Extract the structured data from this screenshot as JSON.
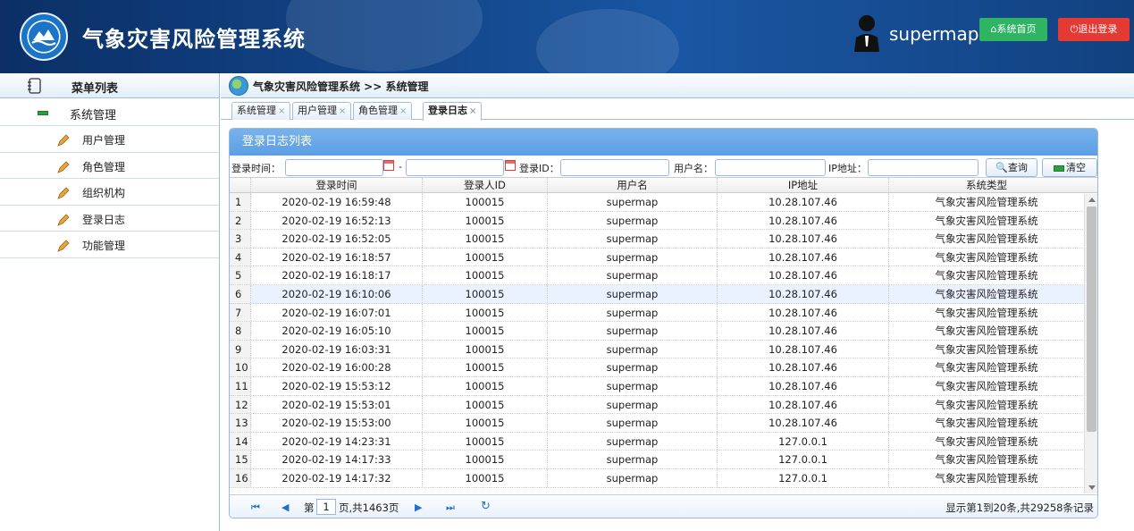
{
  "header": {
    "app_title": "气象灾害风险管理系统",
    "username": "supermap",
    "home_label": "系统首页",
    "logout_label": "退出登录"
  },
  "sidebar": {
    "menu_title": "菜单列表",
    "group_label": "系统管理",
    "items": [
      {
        "label": "用户管理"
      },
      {
        "label": "角色管理"
      },
      {
        "label": "组织机构"
      },
      {
        "label": "登录日志"
      },
      {
        "label": "功能管理"
      }
    ]
  },
  "breadcrumb": {
    "text": "气象灾害风险管理系统 >> 系统管理"
  },
  "tabs": [
    {
      "label": "系统管理",
      "close": "×"
    },
    {
      "label": "用户管理",
      "close": "×"
    },
    {
      "label": "角色管理",
      "close": "×"
    },
    {
      "label": "登录日志",
      "close": "×",
      "active": true
    }
  ],
  "panel": {
    "title": "登录日志列表",
    "search": {
      "login_time_label": "登录时间：",
      "range_sep": "-",
      "login_id_label": "登录ID：",
      "username_label": "用户名：",
      "ip_label": "IP地址：",
      "query_label": "查询",
      "clear_label": "清空"
    },
    "columns": [
      "登录时间",
      "登录人ID",
      "用户名",
      "IP地址",
      "系统类型"
    ],
    "rows": [
      {
        "n": "1",
        "time": "2020-02-19 16:59:48",
        "id": "100015",
        "user": "supermap",
        "ip": "10.28.107.46",
        "sys": "气象灾害风险管理系统"
      },
      {
        "n": "2",
        "time": "2020-02-19 16:52:13",
        "id": "100015",
        "user": "supermap",
        "ip": "10.28.107.46",
        "sys": "气象灾害风险管理系统"
      },
      {
        "n": "3",
        "time": "2020-02-19 16:52:05",
        "id": "100015",
        "user": "supermap",
        "ip": "10.28.107.46",
        "sys": "气象灾害风险管理系统"
      },
      {
        "n": "4",
        "time": "2020-02-19 16:18:57",
        "id": "100015",
        "user": "supermap",
        "ip": "10.28.107.46",
        "sys": "气象灾害风险管理系统"
      },
      {
        "n": "5",
        "time": "2020-02-19 16:18:17",
        "id": "100015",
        "user": "supermap",
        "ip": "10.28.107.46",
        "sys": "气象灾害风险管理系统"
      },
      {
        "n": "6",
        "time": "2020-02-19 16:10:06",
        "id": "100015",
        "user": "supermap",
        "ip": "10.28.107.46",
        "sys": "气象灾害风险管理系统"
      },
      {
        "n": "7",
        "time": "2020-02-19 16:07:01",
        "id": "100015",
        "user": "supermap",
        "ip": "10.28.107.46",
        "sys": "气象灾害风险管理系统"
      },
      {
        "n": "8",
        "time": "2020-02-19 16:05:10",
        "id": "100015",
        "user": "supermap",
        "ip": "10.28.107.46",
        "sys": "气象灾害风险管理系统"
      },
      {
        "n": "9",
        "time": "2020-02-19 16:03:31",
        "id": "100015",
        "user": "supermap",
        "ip": "10.28.107.46",
        "sys": "气象灾害风险管理系统"
      },
      {
        "n": "10",
        "time": "2020-02-19 16:00:28",
        "id": "100015",
        "user": "supermap",
        "ip": "10.28.107.46",
        "sys": "气象灾害风险管理系统"
      },
      {
        "n": "11",
        "time": "2020-02-19 15:53:12",
        "id": "100015",
        "user": "supermap",
        "ip": "10.28.107.46",
        "sys": "气象灾害风险管理系统"
      },
      {
        "n": "12",
        "time": "2020-02-19 15:53:01",
        "id": "100015",
        "user": "supermap",
        "ip": "10.28.107.46",
        "sys": "气象灾害风险管理系统"
      },
      {
        "n": "13",
        "time": "2020-02-19 15:53:00",
        "id": "100015",
        "user": "supermap",
        "ip": "10.28.107.46",
        "sys": "气象灾害风险管理系统"
      },
      {
        "n": "14",
        "time": "2020-02-19 14:23:31",
        "id": "100015",
        "user": "supermap",
        "ip": "127.0.0.1",
        "sys": "气象灾害风险管理系统"
      },
      {
        "n": "15",
        "time": "2020-02-19 14:17:33",
        "id": "100015",
        "user": "supermap",
        "ip": "127.0.0.1",
        "sys": "气象灾害风险管理系统"
      },
      {
        "n": "16",
        "time": "2020-02-19 14:17:32",
        "id": "100015",
        "user": "supermap",
        "ip": "127.0.0.1",
        "sys": "气象灾害风险管理系统"
      }
    ],
    "highlight_row": 6,
    "pager": {
      "page_prefix": "第",
      "page_value": "1",
      "page_suffix": "页,共1463页",
      "summary": "显示第1到20条,共29258条记录"
    }
  },
  "colors": {
    "header_bg": "#124588",
    "home_button": "#2fb464",
    "logout_button": "#e43a33",
    "panel_title": "#6aa9e8",
    "border": "#95b8e7"
  },
  "icons": [
    "logo-icon",
    "user-avatar-icon",
    "home-icon",
    "power-icon",
    "book-icon",
    "minus-icon",
    "pencil-icon",
    "globe-icon",
    "calendar-icon",
    "search-icon",
    "clear-icon"
  ]
}
